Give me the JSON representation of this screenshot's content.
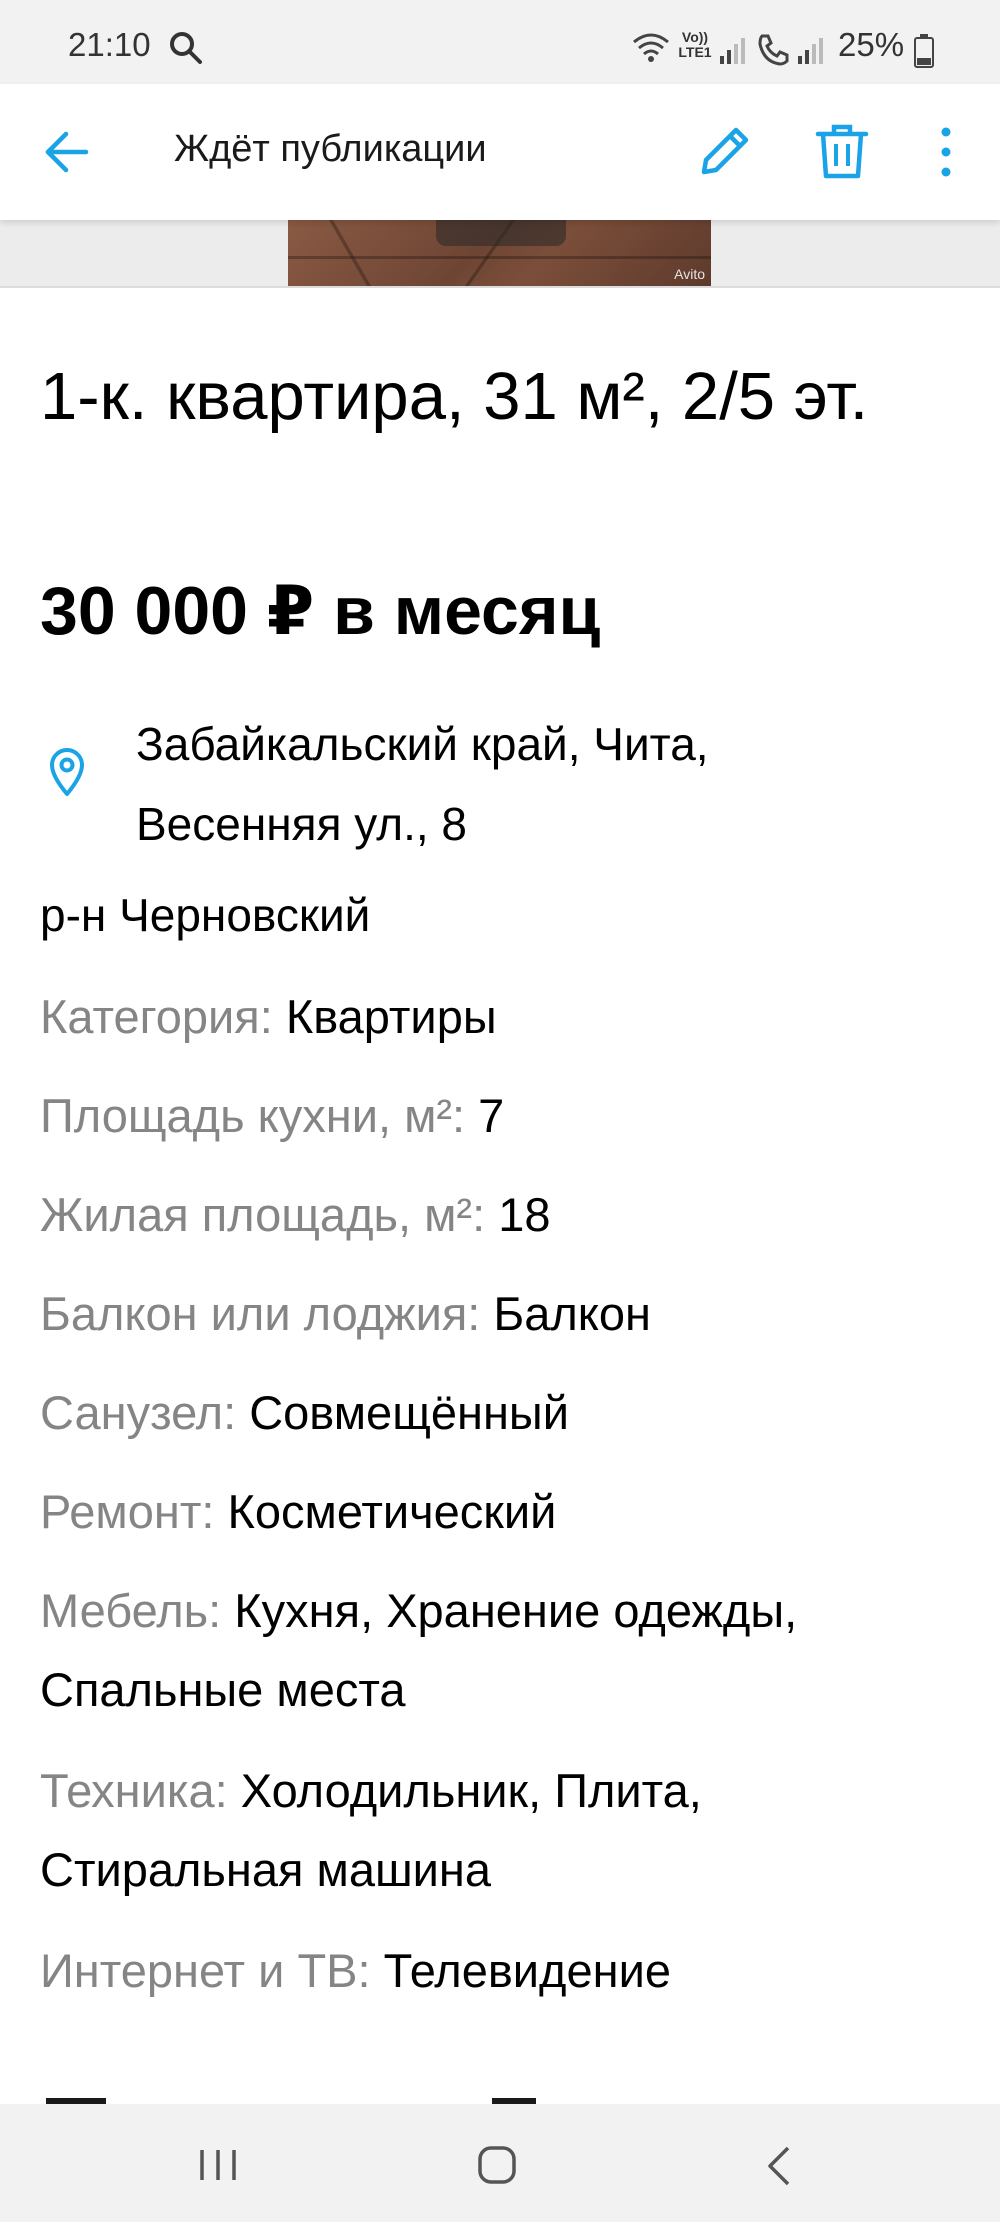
{
  "status_bar": {
    "time": "21:10",
    "lte_label": "Vo))\nLTE1",
    "battery": "25%",
    "icons": [
      "search-icon",
      "wifi-icon",
      "signal-icon",
      "call-icon",
      "signal-icon",
      "battery-icon"
    ]
  },
  "app_bar": {
    "title": "Ждёт публикации",
    "icons": [
      "back-arrow-icon",
      "edit-pencil-icon",
      "trash-icon",
      "more-vertical-icon"
    ],
    "accent_color": "#1aa3e6"
  },
  "photo": {
    "watermark": "Avito"
  },
  "listing": {
    "title": "1-к. квартира, 31 м², 2/5 эт.",
    "price": "30 000 ₽ в месяц",
    "address_line1": "Забайкальский край, Чита,",
    "address_line2": "Весенняя ул., 8",
    "district": "р-н Черновский"
  },
  "params": [
    {
      "label": "Категория:",
      "value": "Квартиры"
    },
    {
      "label": "Площадь кухни, м²:",
      "value": "7"
    },
    {
      "label": "Жилая площадь, м²:",
      "value": "18"
    },
    {
      "label": "Балкон или лоджия:",
      "value": "Балкон"
    },
    {
      "label": "Санузел:",
      "value": "Совмещённый"
    },
    {
      "label": "Ремонт:",
      "value": "Косметический"
    },
    {
      "label": "Мебель:",
      "value": "Кухня, Хранение одежды, Спальные места"
    },
    {
      "label": "Техника:",
      "value": "Холодильник, Плита, Стиральная машина"
    },
    {
      "label": "Интернет и ТВ:",
      "value": "Телевидение"
    }
  ],
  "colors": {
    "label_gray": "#858585",
    "text": "#000000",
    "bars_bg": "#f2f2f2"
  },
  "nav_bar": {
    "icons": [
      "recents-icon",
      "home-icon",
      "back-chevron-icon"
    ]
  }
}
